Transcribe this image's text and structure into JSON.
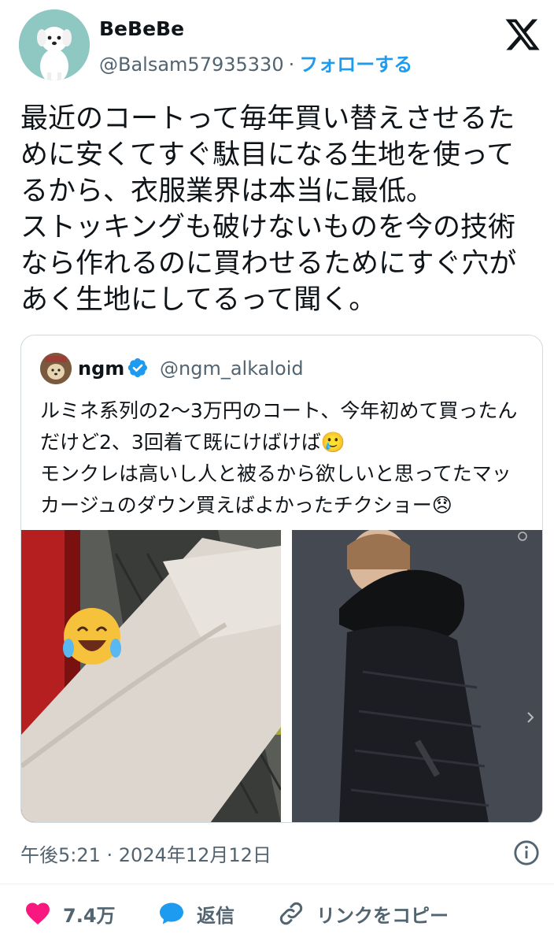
{
  "author": {
    "display_name": "BeBeBe",
    "handle": "@Balsam57935330",
    "separator": "·",
    "follow_label": "フォローする"
  },
  "tweet_text": "最近のコートって毎年買い替えさせるために安くてすぐ駄目になる生地を使ってるから、衣服業界は本当に最低。\nストッキングも破けないものを今の技術なら作れるのに買わせるためにすぐ穴があく生地にしてるって聞く。",
  "quote": {
    "name": "ngm",
    "handle": "@ngm_alkaloid",
    "text": "ルミネ系列の2〜3万円のコート、今年初めて買ったんだけど2、3回着て既にけばけば🥲\nモンクレは高いし人と被るから欲しいと思ってたマッカージュのダウン買えばよかったチクショー😞"
  },
  "timestamp": "午後5:21 · 2024年12月12日",
  "actions": {
    "likes": "7.4万",
    "reply_label": "返信",
    "copy_link_label": "リンクをコピー"
  },
  "colors": {
    "accent": "#1d9bf0",
    "like": "#f91880",
    "secondary_text": "#536471"
  },
  "icons": [
    "x-logo-icon",
    "verified-badge-icon",
    "info-icon",
    "heart-icon",
    "reply-bubble-icon",
    "link-icon",
    "zoom-icon",
    "chevron-right-icon"
  ]
}
